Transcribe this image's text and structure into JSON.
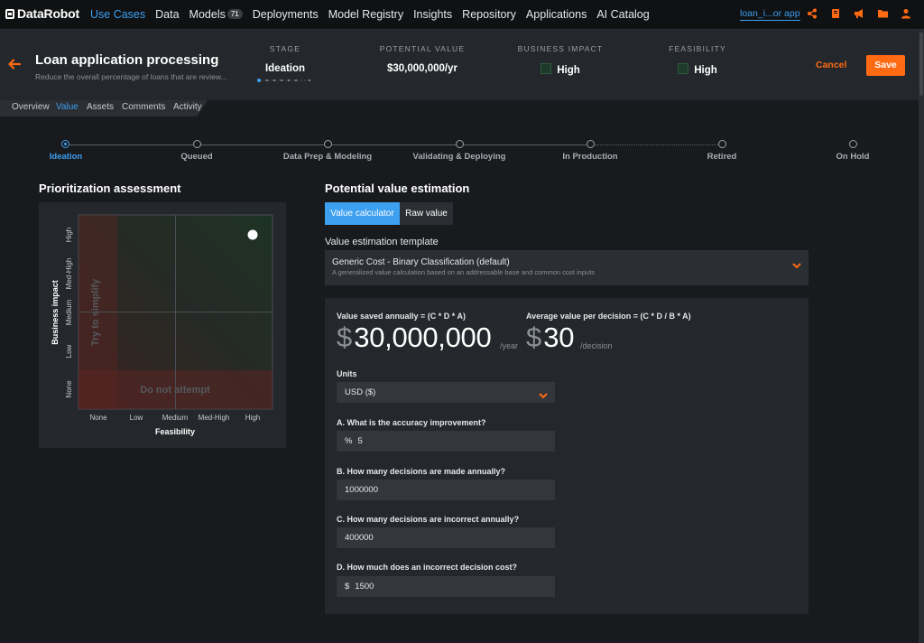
{
  "app": {
    "logo": "DataRobot"
  },
  "nav": {
    "items": [
      {
        "label": "Use Cases",
        "active": true
      },
      {
        "label": "Data"
      },
      {
        "label": "Models",
        "badge": "71"
      },
      {
        "label": "Deployments"
      },
      {
        "label": "Model Registry"
      },
      {
        "label": "Insights"
      },
      {
        "label": "Repository"
      },
      {
        "label": "Applications"
      },
      {
        "label": "AI Catalog"
      }
    ],
    "project_link": "loan_i...or app",
    "icons": [
      "share-icon",
      "notebook-icon",
      "megaphone-icon",
      "folder-icon",
      "user-icon"
    ]
  },
  "header": {
    "title": "Loan application processing",
    "subtitle": "Reduce the overall percentage of loans that are review...",
    "stage": {
      "label": "STAGE",
      "value": "Ideation"
    },
    "potential_value": {
      "label": "POTENTIAL VALUE",
      "value": "$30,000,000/yr"
    },
    "business_impact": {
      "label": "BUSINESS IMPACT",
      "value": "High"
    },
    "feasibility": {
      "label": "FEASIBILITY",
      "value": "High"
    },
    "cancel": "Cancel",
    "save": "Save"
  },
  "tabs": [
    "Overview",
    "Value",
    "Assets",
    "Comments",
    "Activity"
  ],
  "active_tab": "Value",
  "stages": [
    "Ideation",
    "Queued",
    "Data Prep & Modeling",
    "Validating & Deploying",
    "In Production",
    "Retired",
    "On Hold"
  ],
  "active_stage": "Ideation",
  "prioritization": {
    "title": "Prioritization assessment",
    "y_axis_label": "Business impact",
    "x_axis_label": "Feasibility",
    "y_ticks": [
      "High",
      "Med-High",
      "Medium",
      "Low",
      "None"
    ],
    "x_ticks": [
      "None",
      "Low",
      "Medium",
      "Med-High",
      "High"
    ],
    "region_simplify": "Try to simplify",
    "region_not_attempt": "Do not attempt",
    "point": {
      "feasibility": "High",
      "business_impact": "High"
    }
  },
  "value_estimation": {
    "title": "Potential value estimation",
    "tab_calculator": "Value calculator",
    "tab_raw": "Raw value",
    "template_label": "Value estimation template",
    "template_name": "Generic Cost - Binary Classification (default)",
    "template_desc": "A generalized value calculation based on an addressable base and common cost inputs",
    "annual_label": "Value saved annually = (C * D * A)",
    "annual_currency": "$",
    "annual_value": "30,000,000",
    "annual_unit": "/year",
    "per_decision_label": "Average value per decision = (C * D / B * A)",
    "per_decision_currency": "$",
    "per_decision_value": "30",
    "per_decision_unit": "/decision",
    "units_label": "Units",
    "units_value": "USD ($)",
    "q_a": "A. What is the accuracy improvement?",
    "a_prefix": "%",
    "a_value": "5",
    "q_b": "B. How many decisions are made annually?",
    "b_value": "1000000",
    "q_c": "C. How many decisions are incorrect annually?",
    "c_value": "400000",
    "q_d": "D. How much does an incorrect decision cost?",
    "d_prefix": "$",
    "d_value": "1500"
  },
  "colors": {
    "accent": "#3d9ff0",
    "brand": "#ff6a13",
    "bg": "#181a1d"
  }
}
